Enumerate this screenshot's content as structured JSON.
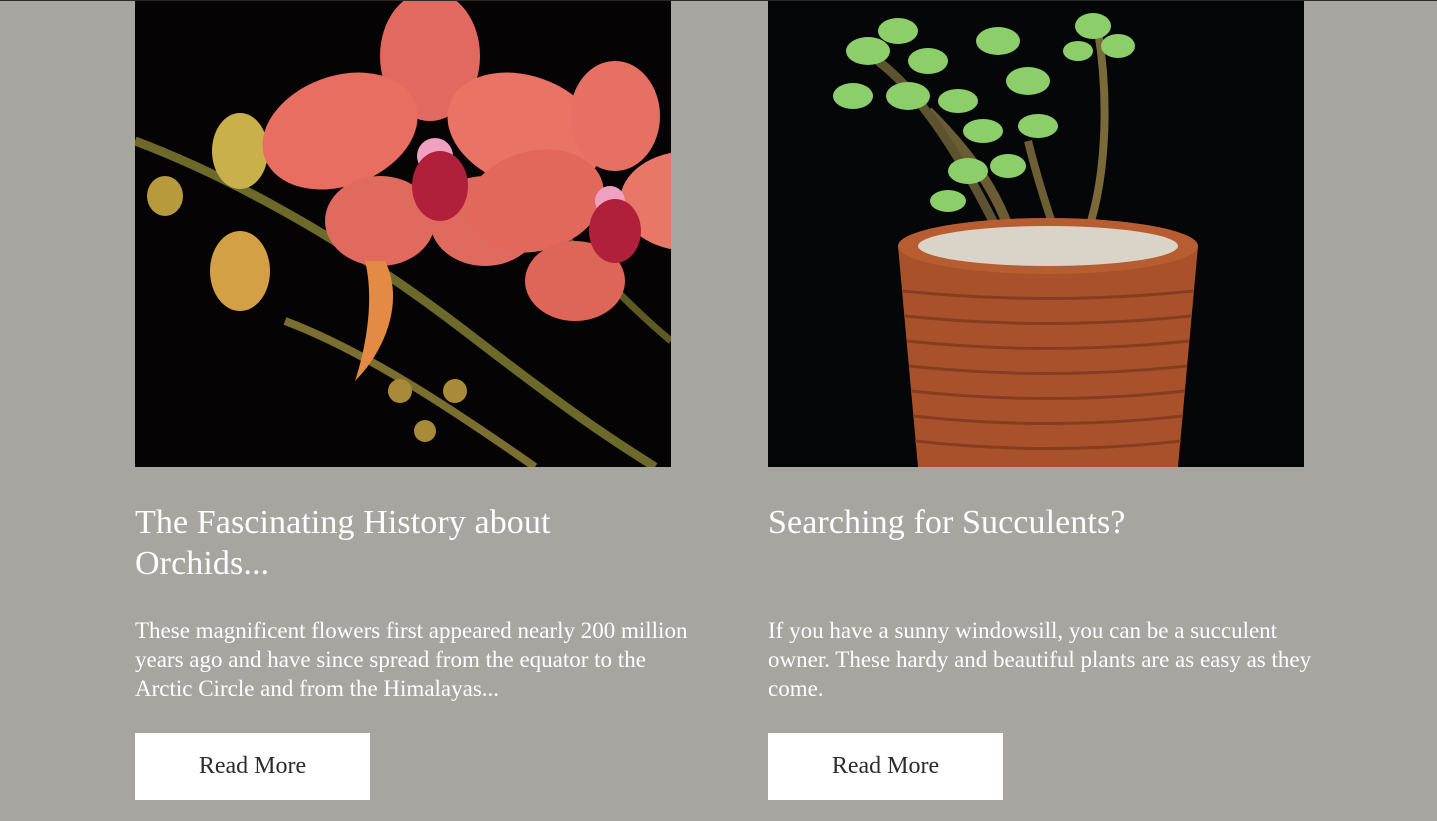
{
  "posts": [
    {
      "title": "The Fascinating History about Orchids...",
      "excerpt": "These magnificent flowers first appeared nearly 200 million years ago and have since spread from the equator to the Arctic Circle and from the Himalayas...",
      "cta_label": "Read More",
      "image_subject": "orchid-photo"
    },
    {
      "title": "Searching for Succulents?",
      "excerpt": "If you have a sunny windowsill, you can be a succulent owner. These hardy and beautiful plants are as easy as they come.",
      "cta_label": "Read More",
      "image_subject": "succulent-photo"
    }
  ],
  "colors": {
    "page_background": "#a6a5a0",
    "heading_text": "#ffffff",
    "button_background": "#ffffff",
    "button_text": "#2b2b2b"
  }
}
